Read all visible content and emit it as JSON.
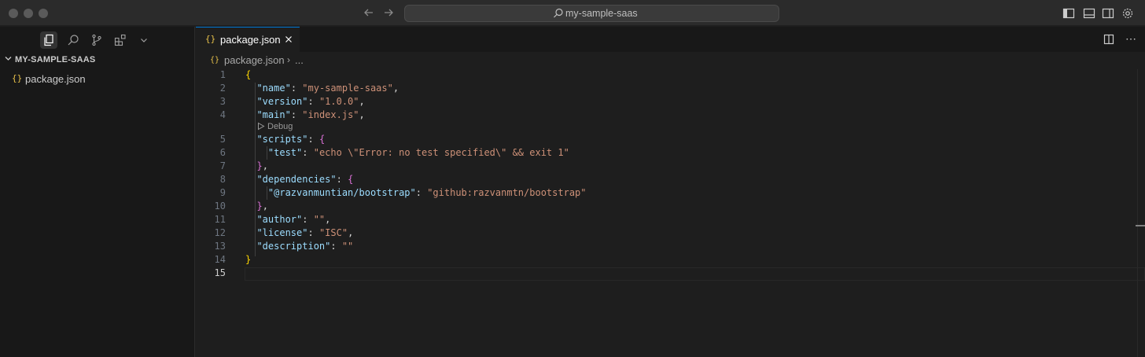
{
  "window": {
    "command_center": "my-sample-saas",
    "search_icon": "search-icon"
  },
  "sidebar": {
    "explorer_title": "MY-SAMPLE-SAAS",
    "files": [
      {
        "icon": "{}",
        "name": "package.json"
      }
    ]
  },
  "editor": {
    "tab": {
      "icon": "{}",
      "label": "package.json"
    },
    "breadcrumb": {
      "icon": "{}",
      "file": "package.json",
      "separator": "›",
      "more": "..."
    },
    "codelens": "Debug",
    "current_line": 15,
    "lines": [
      {
        "n": "1",
        "tokens": [
          [
            "b1",
            "{"
          ]
        ]
      },
      {
        "n": "2",
        "tokens": [
          [
            "p",
            "  "
          ],
          [
            "k",
            "\"name\""
          ],
          [
            "p",
            ": "
          ],
          [
            "s",
            "\"my-sample-saas\""
          ],
          [
            "p",
            ","
          ]
        ]
      },
      {
        "n": "3",
        "tokens": [
          [
            "p",
            "  "
          ],
          [
            "k",
            "\"version\""
          ],
          [
            "p",
            ": "
          ],
          [
            "s",
            "\"1.0.0\""
          ],
          [
            "p",
            ","
          ]
        ]
      },
      {
        "n": "4",
        "tokens": [
          [
            "p",
            "  "
          ],
          [
            "k",
            "\"main\""
          ],
          [
            "p",
            ": "
          ],
          [
            "s",
            "\"index.js\""
          ],
          [
            "p",
            ","
          ]
        ]
      },
      {
        "n": "5",
        "tokens": [
          [
            "p",
            "  "
          ],
          [
            "k",
            "\"scripts\""
          ],
          [
            "p",
            ": "
          ],
          [
            "b2",
            "{"
          ]
        ]
      },
      {
        "n": "6",
        "tokens": [
          [
            "p",
            "    "
          ],
          [
            "k",
            "\"test\""
          ],
          [
            "p",
            ": "
          ],
          [
            "s",
            "\"echo \\\"Error: no test specified\\\" && exit 1\""
          ]
        ]
      },
      {
        "n": "7",
        "tokens": [
          [
            "p",
            "  "
          ],
          [
            "b2",
            "}"
          ],
          [
            "p",
            ","
          ]
        ]
      },
      {
        "n": "8",
        "tokens": [
          [
            "p",
            "  "
          ],
          [
            "k",
            "\"dependencies\""
          ],
          [
            "p",
            ": "
          ],
          [
            "b2",
            "{"
          ]
        ]
      },
      {
        "n": "9",
        "tokens": [
          [
            "p",
            "    "
          ],
          [
            "k",
            "\"@razvanmuntian/bootstrap\""
          ],
          [
            "p",
            ": "
          ],
          [
            "s",
            "\"github:razvanmtn/bootstrap\""
          ]
        ]
      },
      {
        "n": "10",
        "tokens": [
          [
            "p",
            "  "
          ],
          [
            "b2",
            "}"
          ],
          [
            "p",
            ","
          ]
        ]
      },
      {
        "n": "11",
        "tokens": [
          [
            "p",
            "  "
          ],
          [
            "k",
            "\"author\""
          ],
          [
            "p",
            ": "
          ],
          [
            "s",
            "\"\""
          ],
          [
            "p",
            ","
          ]
        ]
      },
      {
        "n": "12",
        "tokens": [
          [
            "p",
            "  "
          ],
          [
            "k",
            "\"license\""
          ],
          [
            "p",
            ": "
          ],
          [
            "s",
            "\"ISC\""
          ],
          [
            "p",
            ","
          ]
        ]
      },
      {
        "n": "13",
        "tokens": [
          [
            "p",
            "  "
          ],
          [
            "k",
            "\"description\""
          ],
          [
            "p",
            ": "
          ],
          [
            "s",
            "\"\""
          ]
        ]
      },
      {
        "n": "14",
        "tokens": [
          [
            "b1",
            "}"
          ]
        ]
      },
      {
        "n": "15",
        "tokens": []
      }
    ]
  },
  "colors": {
    "key": "#9cdcfe",
    "string": "#ce9178",
    "bracket_level1": "#ffd700",
    "bracket_level2": "#da70d6",
    "tab_accent": "#0078d4"
  }
}
